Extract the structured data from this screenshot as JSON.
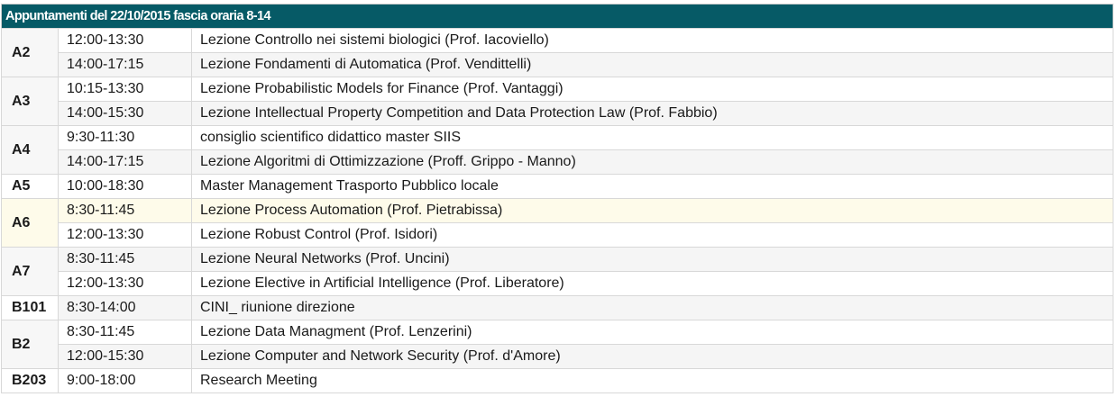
{
  "title": "Appuntamenti del 22/10/2015 fascia oraria 8-14",
  "groups": [
    {
      "room": "A2",
      "entries": [
        {
          "time": "12:00-13:30",
          "desc": "Lezione Controllo nei sistemi biologici (Prof. Iacoviello)"
        },
        {
          "time": "14:00-17:15",
          "desc": "Lezione Fondamenti di Automatica (Prof. Vendittelli)"
        }
      ]
    },
    {
      "room": "A3",
      "entries": [
        {
          "time": "10:15-13:30",
          "desc": "Lezione Probabilistic Models for Finance (Prof. Vantaggi)"
        },
        {
          "time": "14:00-15:30",
          "desc": "Lezione Intellectual Property Competition and Data Protection Law (Prof. Fabbio)"
        }
      ]
    },
    {
      "room": "A4",
      "entries": [
        {
          "time": "9:30-11:30",
          "desc": "consiglio scientifico didattico master SIIS"
        },
        {
          "time": "14:00-17:15",
          "desc": "Lezione Algoritmi di Ottimizzazione (Proff. Grippo - Manno)"
        }
      ]
    },
    {
      "room": "A5",
      "entries": [
        {
          "time": "10:00-18:30",
          "desc": "Master Management Trasporto Pubblico locale"
        }
      ]
    },
    {
      "room": "A6",
      "entries": [
        {
          "time": "8:30-11:45",
          "desc": "Lezione Process Automation (Prof. Pietrabissa)"
        },
        {
          "time": "12:00-13:30",
          "desc": "Lezione Robust Control (Prof. Isidori)"
        }
      ]
    },
    {
      "room": "A7",
      "entries": [
        {
          "time": "8:30-11:45",
          "desc": "Lezione Neural Networks (Prof. Uncini)"
        },
        {
          "time": "12:00-13:30",
          "desc": "Lezione Elective in Artificial Intelligence (Prof. Liberatore)"
        }
      ]
    },
    {
      "room": "B101",
      "entries": [
        {
          "time": "8:30-14:00",
          "desc": "CINI_ riunione direzione"
        }
      ]
    },
    {
      "room": "B2",
      "entries": [
        {
          "time": "8:30-11:45",
          "desc": "Lezione Data Managment (Prof. Lenzerini)"
        },
        {
          "time": "12:00-15:30",
          "desc": "Lezione Computer and Network Security (Prof. d'Amore)"
        }
      ]
    },
    {
      "room": "B203",
      "entries": [
        {
          "time": "9:00-18:00",
          "desc": "Research Meeting"
        }
      ]
    }
  ]
}
